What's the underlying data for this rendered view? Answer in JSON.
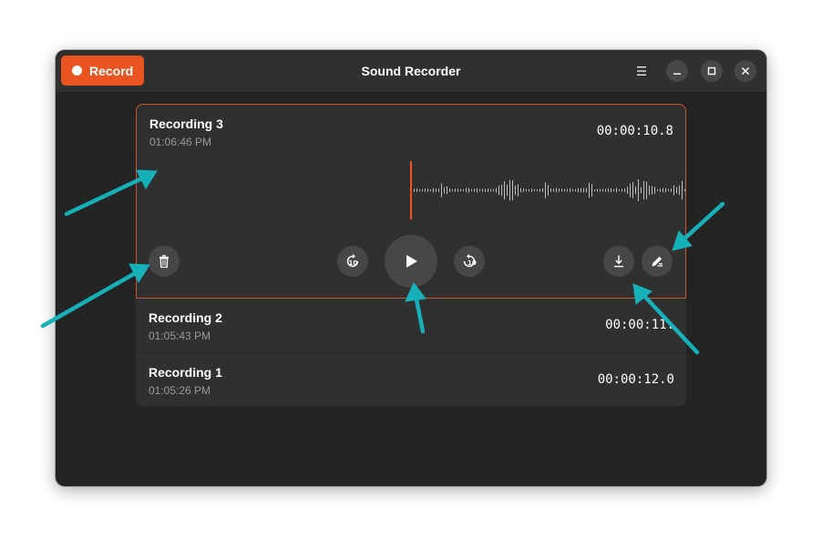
{
  "header": {
    "record_label": "Record",
    "title": "Sound Recorder"
  },
  "recordings": [
    {
      "name": "Recording 3",
      "time": "01:06:46 PM",
      "duration": "00:00:10.8",
      "expanded": true
    },
    {
      "name": "Recording 2",
      "time": "01:05:43 PM",
      "duration": "00:00:11.",
      "expanded": false
    },
    {
      "name": "Recording 1",
      "time": "01:05:26 PM",
      "duration": "00:00:12.0",
      "expanded": false
    }
  ],
  "player": {
    "skip_back_label": "10",
    "skip_forward_label": "10"
  },
  "colors": {
    "accent": "#e95420",
    "window_bg": "#242424",
    "card_bg": "#303030",
    "button_bg": "#474747",
    "annotation_arrow": "#16b0b8"
  },
  "icons": [
    "record-dot-icon",
    "menu-icon",
    "minimize-icon",
    "maximize-icon",
    "close-icon",
    "trash-icon",
    "skip-back-icon",
    "play-icon",
    "skip-forward-icon",
    "export-icon",
    "rename-icon"
  ]
}
